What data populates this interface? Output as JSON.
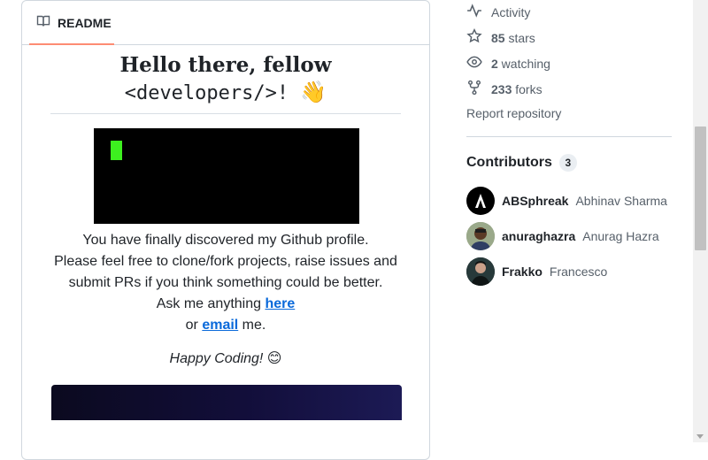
{
  "readme": {
    "tab_label": "README",
    "heading_line1": "Hello there, fellow",
    "heading_code": "<developers/>",
    "heading_bang": "!",
    "heading_emoji": "👋",
    "intro_line1": "You have finally discovered my Github profile.",
    "intro_line2": "Please feel free to clone/fork projects, raise issues and",
    "intro_line3": "submit PRs if you think something could be better.",
    "ask_prefix": "Ask me anything ",
    "ask_link": "here",
    "or_prefix": "or ",
    "email_link": "email",
    "or_suffix": " me.",
    "happy_coding": "Happy Coding! 😊"
  },
  "sidebar": {
    "activity": {
      "label": "Activity",
      "icon": "pulse-icon"
    },
    "stars": {
      "count": "85",
      "label": " stars",
      "icon": "star-icon"
    },
    "watching": {
      "count": "2",
      "label": " watching",
      "icon": "eye-icon"
    },
    "forks": {
      "count": "233",
      "label": " forks",
      "icon": "repo-forked-icon"
    },
    "report": "Report repository",
    "contributors_title": "Contributors",
    "contributors_count": "3",
    "contributors": [
      {
        "login": "ABSphreak",
        "name": "Abhinav Sharma"
      },
      {
        "login": "anuraghazra",
        "name": "Anurag Hazra"
      },
      {
        "login": "Frakko",
        "name": "Francesco"
      }
    ]
  },
  "colors": {
    "accent_link": "#0969da",
    "tab_underline": "#fd8c73",
    "terminal_cursor": "#3df01f"
  }
}
